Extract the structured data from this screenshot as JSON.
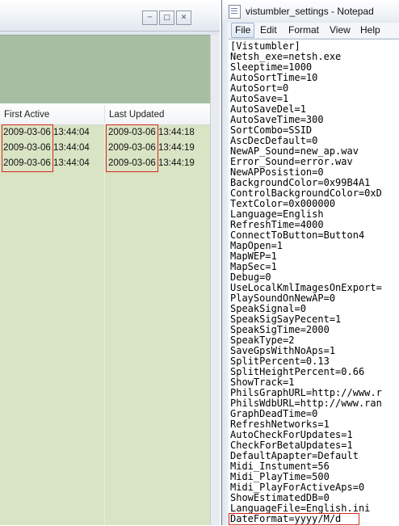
{
  "vistumbler": {
    "columns": [
      "First Active",
      "Last Updated"
    ],
    "rows": [
      {
        "first_date": "2009-03-06",
        "first_time": "13:44:04",
        "last_date": "2009-03-06",
        "last_time": "13:44:18"
      },
      {
        "first_date": "2009-03-06",
        "first_time": "13:44:04",
        "last_date": "2009-03-06",
        "last_time": "13:44:19"
      },
      {
        "first_date": "2009-03-06",
        "first_time": "13:44:04",
        "last_date": "2009-03-06",
        "last_time": "13:44:19"
      }
    ]
  },
  "notepad": {
    "title": "vistumbler_settings - Notepad",
    "menu": [
      "File",
      "Edit",
      "Format",
      "View",
      "Help"
    ],
    "lines": [
      "[Vistumbler]",
      "Netsh_exe=netsh.exe",
      "Sleeptime=1000",
      "AutoSortTime=10",
      "AutoSort=0",
      "AutoSave=1",
      "AutoSaveDel=1",
      "AutoSaveTime=300",
      "SortCombo=SSID",
      "AscDecDefault=0",
      "NewAP_Sound=new_ap.wav",
      "Error_Sound=error.wav",
      "NewAPPosistion=0",
      "BackgroundColor=0x99B4A1",
      "ControlBackgroundColor=0xD",
      "TextColor=0x000000",
      "Language=English",
      "RefreshTime=4000",
      "ConnectToButton=Button4",
      "MapOpen=1",
      "MapWEP=1",
      "MapSec=1",
      "Debug=0",
      "UseLocalKmlImagesOnExport=",
      "PlaySoundOnNewAP=0",
      "SpeakSignal=0",
      "SpeakSigSayPecent=1",
      "SpeakSigTime=2000",
      "SpeakType=2",
      "SaveGpsWithNoAps=1",
      "SplitPercent=0.13",
      "SplitHeightPercent=0.66",
      "ShowTrack=1",
      "PhilsGraphURL=http://www.r",
      "PhilsWdbURL=http://www.ran",
      "GraphDeadTime=0",
      "RefreshNetworks=1",
      "AutoCheckForUpdates=1",
      "CheckForBetaUpdates=1",
      "DefaultApapter=Default",
      "Midi_Instument=56",
      "Midi_PlayTime=500",
      "Midi_PlayForActiveAps=0",
      "ShowEstimatedDB=0",
      "LanguageFile=English.ini",
      "DateFormat=yyyy/M/d"
    ]
  },
  "colors": {
    "list_bg": "#d9e4c4",
    "panel_bg": "#a7bea3",
    "highlight": "#d9261c"
  }
}
